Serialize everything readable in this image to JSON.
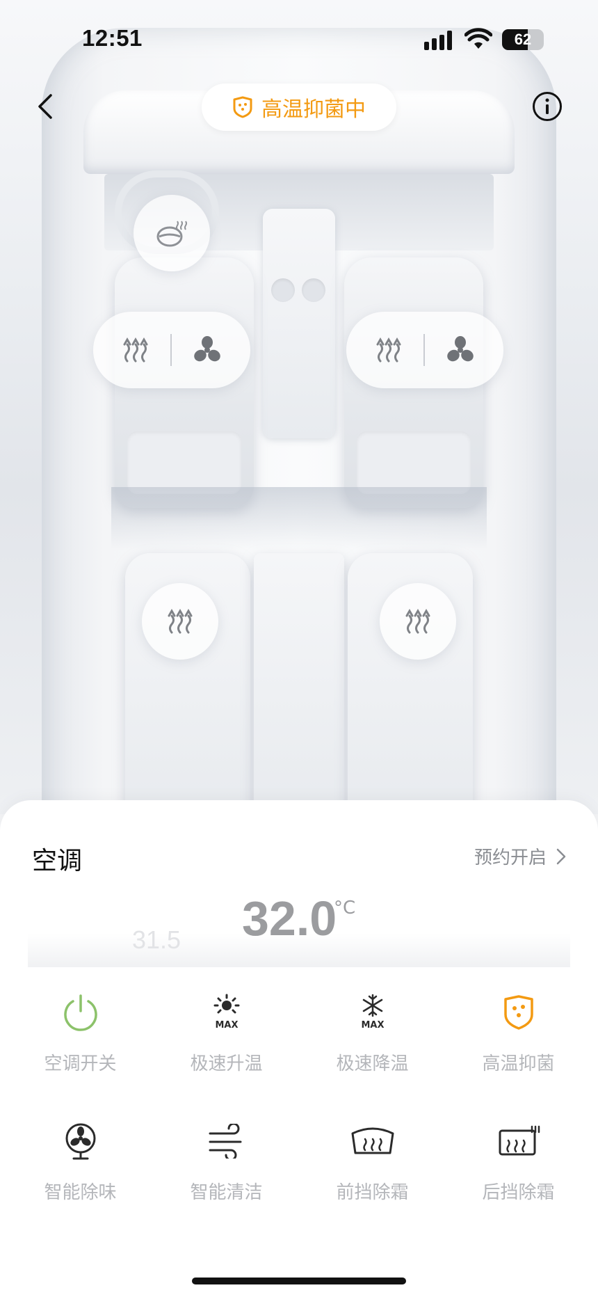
{
  "status_bar": {
    "time": "12:51",
    "battery_level": "62",
    "battery_percent": 62,
    "icons": [
      "cellular-signal-icon",
      "wifi-icon",
      "battery-icon"
    ]
  },
  "nav": {
    "back_icon": "chevron-left-icon",
    "mode_label": "高温抑菌中",
    "mode_icon": "shield-bacteria-icon",
    "info_icon": "info-icon"
  },
  "colors": {
    "accent_orange": "#f39a12",
    "power_green": "#8cc26a",
    "inactive_text": "#b4b6ba",
    "icon_dark": "#2b2b2b"
  },
  "car_controls": {
    "steering_heat_icon": "steering-wheel-heat-icon",
    "seat_heat_icon": "seat-heat-icon",
    "seat_fan_icon": "seat-ventilation-fan-icon"
  },
  "sheet": {
    "title": "空调",
    "schedule_label": "预约开启",
    "temperature": {
      "previous": "31.5",
      "current": "32.0",
      "unit": "°C"
    },
    "controls": [
      {
        "label": "空调开关",
        "icon": "power-icon",
        "active": true
      },
      {
        "label": "极速升温",
        "icon": "max-heat-sun-icon",
        "active": false
      },
      {
        "label": "极速降温",
        "icon": "max-cool-snowflake-icon",
        "active": false
      },
      {
        "label": "高温抑菌",
        "icon": "shield-bacteria-icon",
        "active": true
      },
      {
        "label": "智能除味",
        "icon": "fan-deodorize-icon",
        "active": false
      },
      {
        "label": "智能清洁",
        "icon": "wind-clean-icon",
        "active": false
      },
      {
        "label": "前挡除霜",
        "icon": "front-defrost-icon",
        "active": false
      },
      {
        "label": "后挡除霜",
        "icon": "rear-defrost-icon",
        "active": false
      }
    ]
  }
}
